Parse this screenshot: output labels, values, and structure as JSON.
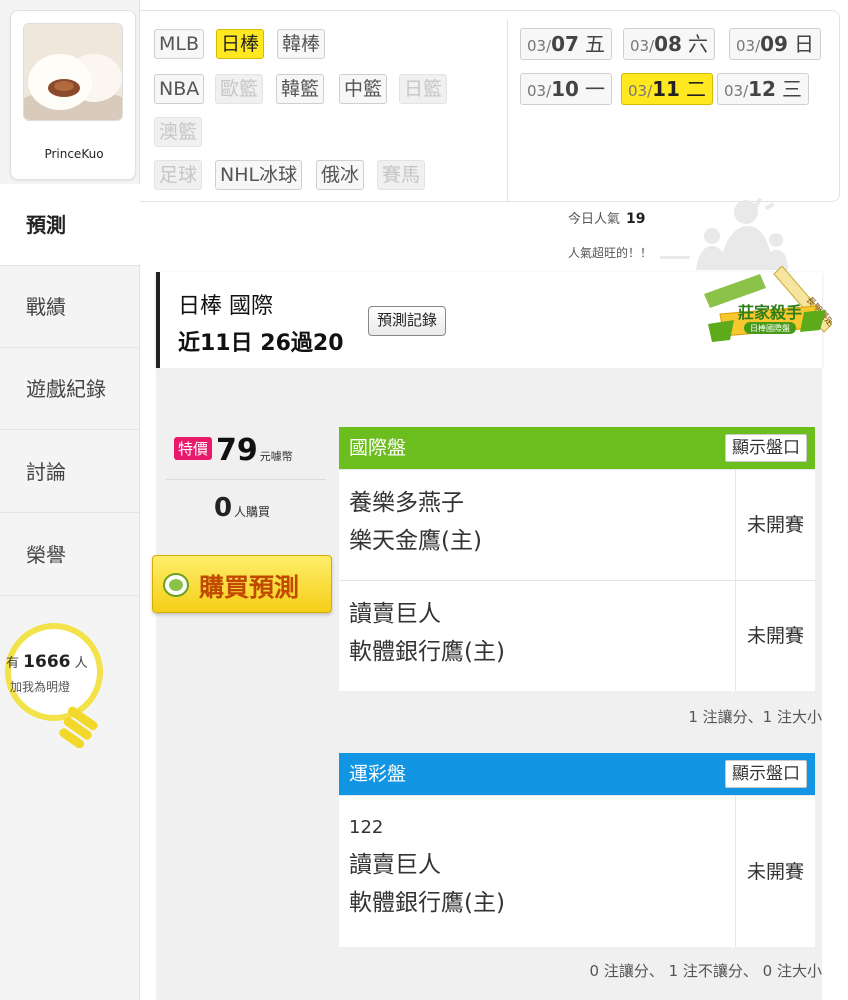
{
  "user": {
    "name": "PrinceKuo"
  },
  "sidebar": {
    "items": [
      {
        "label": "預測",
        "active": true
      },
      {
        "label": "戰績"
      },
      {
        "label": "遊戲紀錄"
      },
      {
        "label": "討論"
      },
      {
        "label": "榮譽"
      }
    ],
    "lights": {
      "prefix": "有",
      "count": "1666",
      "suffix": "人",
      "text": "加我為明燈"
    }
  },
  "filters": {
    "tags": [
      {
        "label": "MLB"
      },
      {
        "label": "日棒",
        "active": true
      },
      {
        "label": "韓棒"
      },
      {
        "label": "NBA"
      },
      {
        "label": "歐籃",
        "disabled": true
      },
      {
        "label": "韓籃"
      },
      {
        "label": "中籃"
      },
      {
        "label": "日籃",
        "disabled": true
      },
      {
        "label": "澳籃",
        "disabled": true
      },
      {
        "label": "足球",
        "disabled": true
      },
      {
        "label": "NHL冰球"
      },
      {
        "label": "俄冰"
      },
      {
        "label": "賽馬",
        "disabled": true
      }
    ],
    "dates": [
      {
        "md": "03/",
        "day": "07",
        "weekday": "五"
      },
      {
        "md": "03/",
        "day": "08",
        "weekday": "六"
      },
      {
        "md": "03/",
        "day": "09",
        "weekday": "日"
      },
      {
        "md": "03/",
        "day": "10",
        "weekday": "一"
      },
      {
        "md": "03/",
        "day": "11",
        "weekday": "二",
        "active": true
      },
      {
        "md": "03/",
        "day": "12",
        "weekday": "三"
      }
    ]
  },
  "popularity": {
    "label": "今日人氣",
    "value": "19",
    "note": "人氣超旺的！！"
  },
  "header": {
    "title": "日棒 國際",
    "stats": "近11日 26過20",
    "history_button": "預測記錄",
    "badge_title": "莊家殺手",
    "badge_sub": "日棒國際盤",
    "badge_ribbon": "長期穩定"
  },
  "purchase": {
    "special_label": "特價",
    "price": "79",
    "unit": "元噱幣",
    "buyers": "0",
    "buyers_unit": "人購買",
    "buy_label": "購買預測"
  },
  "panels": [
    {
      "title": "國際盤",
      "color": "#6cbd1e",
      "button": "顯示盤口",
      "matches": [
        {
          "code": "",
          "away": "養樂多燕子",
          "home": "樂天金鷹(主)",
          "status": "未開賽"
        },
        {
          "code": "",
          "away": "讀賣巨人",
          "home": "軟體銀行鷹(主)",
          "status": "未開賽"
        }
      ],
      "summary": "1 注讓分、1 注大小"
    },
    {
      "title": "運彩盤",
      "color": "#1296e3",
      "button": "顯示盤口",
      "matches": [
        {
          "code": "122",
          "away": "讀賣巨人",
          "home": "軟體銀行鷹(主)",
          "status": "未開賽"
        }
      ],
      "summary": "0 注讓分、 1 注不讓分、 0 注大小"
    }
  ]
}
